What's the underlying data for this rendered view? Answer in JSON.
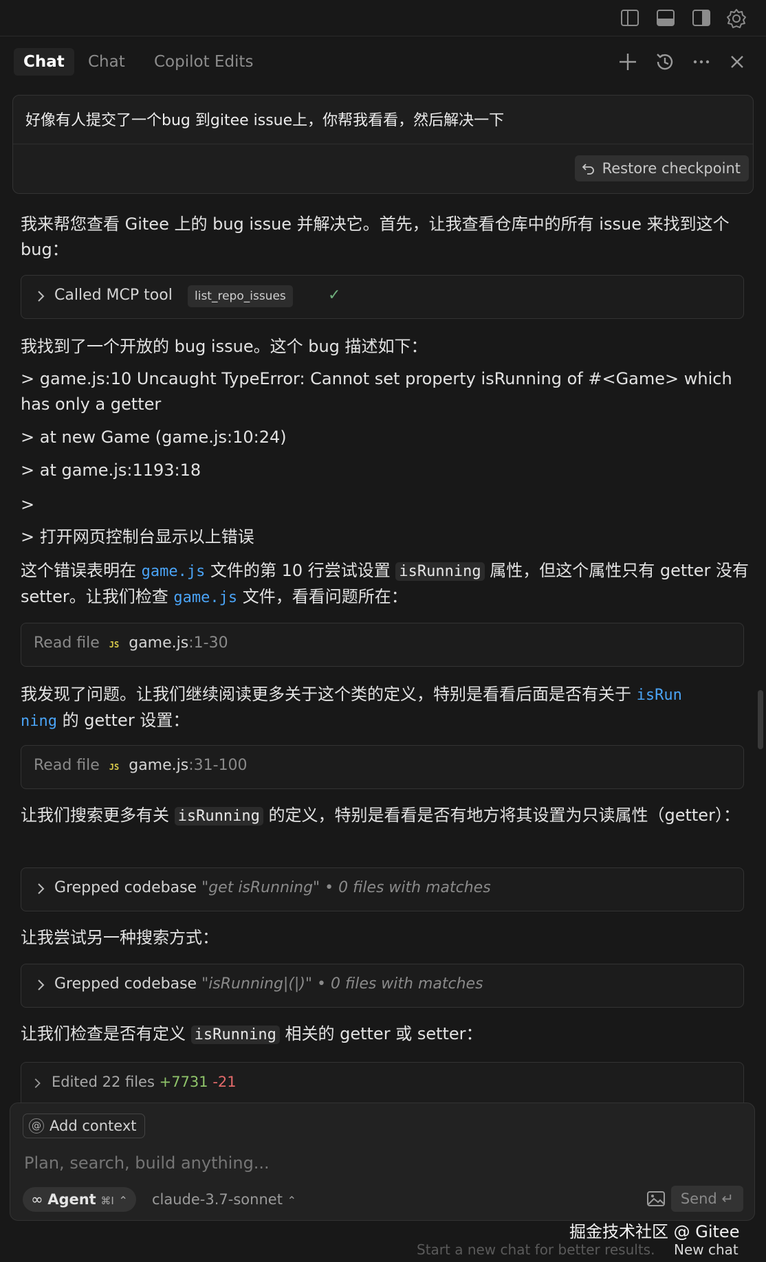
{
  "window": {
    "icons": [
      "sidebar-left-icon",
      "panel-bottom-icon",
      "sidebar-right-icon",
      "gear-icon"
    ]
  },
  "header": {
    "tabs": [
      {
        "label": "Chat",
        "active": true
      },
      {
        "label": "Chat",
        "active": false
      },
      {
        "label": "Copilot Edits",
        "active": false
      }
    ],
    "actions": [
      "plus-icon",
      "history-icon",
      "more-icon",
      "close-icon"
    ]
  },
  "user_message": {
    "text": "好像有人提交了一个bug 到gitee issue上，你帮我看看，然后解决一下",
    "restore_label": "Restore checkpoint"
  },
  "conversation": {
    "p1": "我来帮您查看 Gitee 上的 bug issue 并解决它。首先，让我查看仓库中的所有 issue 来找到这个 bug：",
    "mcp_call": {
      "label": "Called MCP tool",
      "tool": "list_repo_issues",
      "status": "✓"
    },
    "p2": "我找到了一个开放的 bug issue。这个 bug 描述如下：",
    "quote1": "> game.js:10 Uncaught TypeError: Cannot set property isRunning of #<Game> which has only a getter",
    "quote2": "> at new Game (game.js:10:24)",
    "quote3": "> at game.js:1193:18",
    "quote4": ">",
    "quote5": "> 打开网页控制台显示以上错误",
    "p3": {
      "a": "这个错误表明在 ",
      "file1": "game.js",
      "b": " 文件的第 10 行尝试设置 ",
      "code1": "isRunning",
      "c": " 属性，但这个属性只有 getter 没有 setter。让我们检查 ",
      "file2": "game.js",
      "d": " 文件，看看问题所在："
    },
    "read1": {
      "label": "Read file",
      "badge": "JS",
      "file": "game.js",
      "range": ":1-30"
    },
    "p4": {
      "a": "我发现了问题。让我们继续阅读更多关于这个类的定义，特别是看看后面是否有关于 ",
      "link1": "isRun",
      "link2": "ning",
      "b": " 的 getter 设置："
    },
    "read2": {
      "label": "Read file",
      "badge": "JS",
      "file": "game.js",
      "range": ":31-100"
    },
    "p5": {
      "a": "让我们搜索更多有关 ",
      "code": "isRunning",
      "b": " 的定义，特别是看看是否有地方将其设置为只读属性（getter）："
    },
    "grep1": {
      "label": "Grepped codebase",
      "query": "\"get isRunning\"",
      "result": "• 0 files with matches"
    },
    "p6": "让我尝试另一种搜索方式：",
    "grep2": {
      "label": "Grepped codebase",
      "query": "\"isRunning|(|)\"",
      "result": "• 0 files with matches"
    },
    "p7": {
      "a": "让我们检查是否有定义 ",
      "code": "isRunning",
      "b": " 相关的 getter 或 setter："
    }
  },
  "composer": {
    "edited": {
      "label": "Edited 22 files",
      "added": "+7731",
      "removed": "-21"
    },
    "add_context": "Add context",
    "placeholder": "Plan, search, build anything...",
    "agent_label": "Agent",
    "agent_shortcut": "⌘I",
    "model": "claude-3.7-sonnet",
    "send_label": "Send"
  },
  "footer": {
    "hint": "Start a new chat for better results.",
    "new_chat": "New chat",
    "watermark": "掘金技术社区 @ Gitee"
  },
  "colors": {
    "accent_link": "#4aa3f5",
    "added": "#8fc46a",
    "removed": "#e36a6a",
    "js_badge": "#d7c94a"
  }
}
